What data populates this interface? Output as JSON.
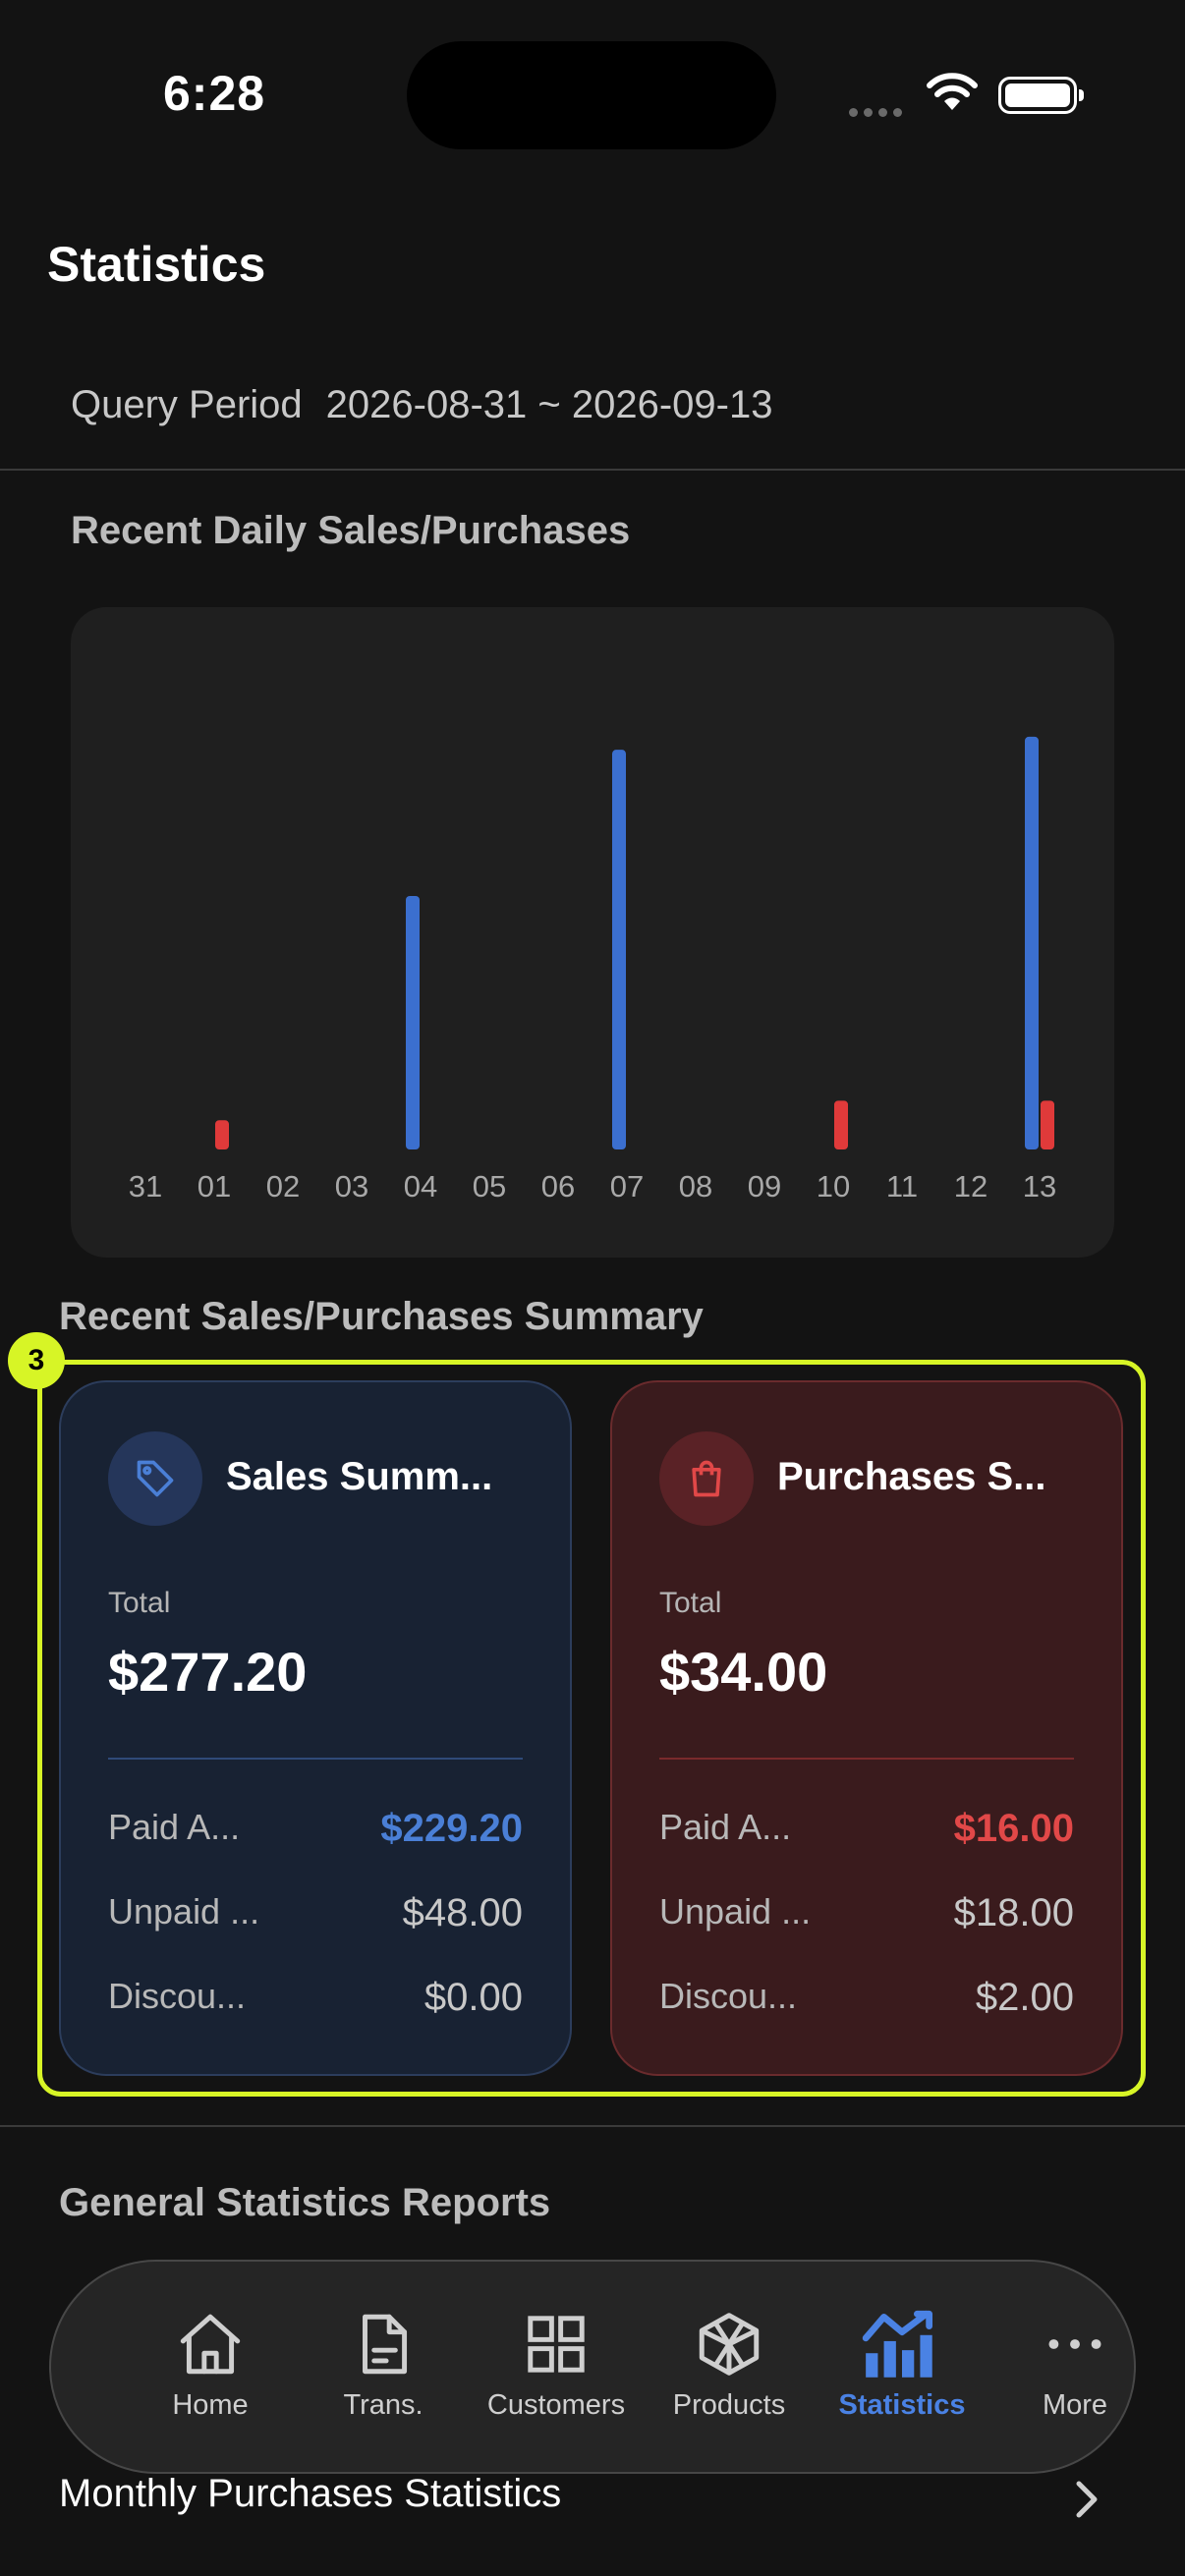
{
  "status_bar": {
    "time": "6:28"
  },
  "page": {
    "title": "Statistics"
  },
  "query": {
    "label": "Query Period",
    "value": "2026-08-31 ~ 2026-09-13"
  },
  "daily_section": {
    "title": "Recent Daily Sales/Purchases"
  },
  "chart_data": {
    "type": "bar",
    "categories": [
      "31",
      "01",
      "02",
      "03",
      "04",
      "05",
      "06",
      "07",
      "08",
      "09",
      "10",
      "11",
      "12",
      "13"
    ],
    "series": [
      {
        "color": "#3b6fcf",
        "values": [
          0,
          0,
          0,
          0,
          156,
          0,
          0,
          246,
          0,
          0,
          0,
          0,
          0,
          254
        ]
      },
      {
        "color": "#e03a3a",
        "values": [
          0,
          18,
          0,
          0,
          0,
          0,
          0,
          0,
          0,
          0,
          30,
          0,
          0,
          30
        ]
      }
    ],
    "ylim": [
      0,
      260
    ],
    "grid": false,
    "legend": "none"
  },
  "summary_section": {
    "title": "Recent Sales/Purchases Summary"
  },
  "highlight_badge": "3",
  "sales_card": {
    "icon": "tag-icon",
    "title": "Sales Summ...",
    "total_label": "Total",
    "total": "$277.20",
    "rows": [
      {
        "label": "Paid A...",
        "value": "$229.20"
      },
      {
        "label": "Unpaid ...",
        "value": "$48.00"
      },
      {
        "label": "Discou...",
        "value": "$0.00"
      }
    ],
    "accent_color": "#4a7fd6"
  },
  "purchases_card": {
    "icon": "shopping-bag-icon",
    "title": "Purchases S...",
    "total_label": "Total",
    "total": "$34.00",
    "rows": [
      {
        "label": "Paid A...",
        "value": "$16.00"
      },
      {
        "label": "Unpaid ...",
        "value": "$18.00"
      },
      {
        "label": "Discou...",
        "value": "$2.00"
      }
    ],
    "accent_color": "#e14848"
  },
  "general_section": {
    "title": "General Statistics Reports"
  },
  "monthly_row": {
    "label": "Monthly Purchases Statistics"
  },
  "tabs": [
    {
      "label": "Home",
      "icon": "home-icon"
    },
    {
      "label": "Trans.",
      "icon": "document-icon"
    },
    {
      "label": "Customers",
      "icon": "grid-icon"
    },
    {
      "label": "Products",
      "icon": "cube-icon"
    },
    {
      "label": "Statistics",
      "icon": "bar-chart-icon",
      "active": true
    },
    {
      "label": "More",
      "icon": "more-icon"
    }
  ]
}
